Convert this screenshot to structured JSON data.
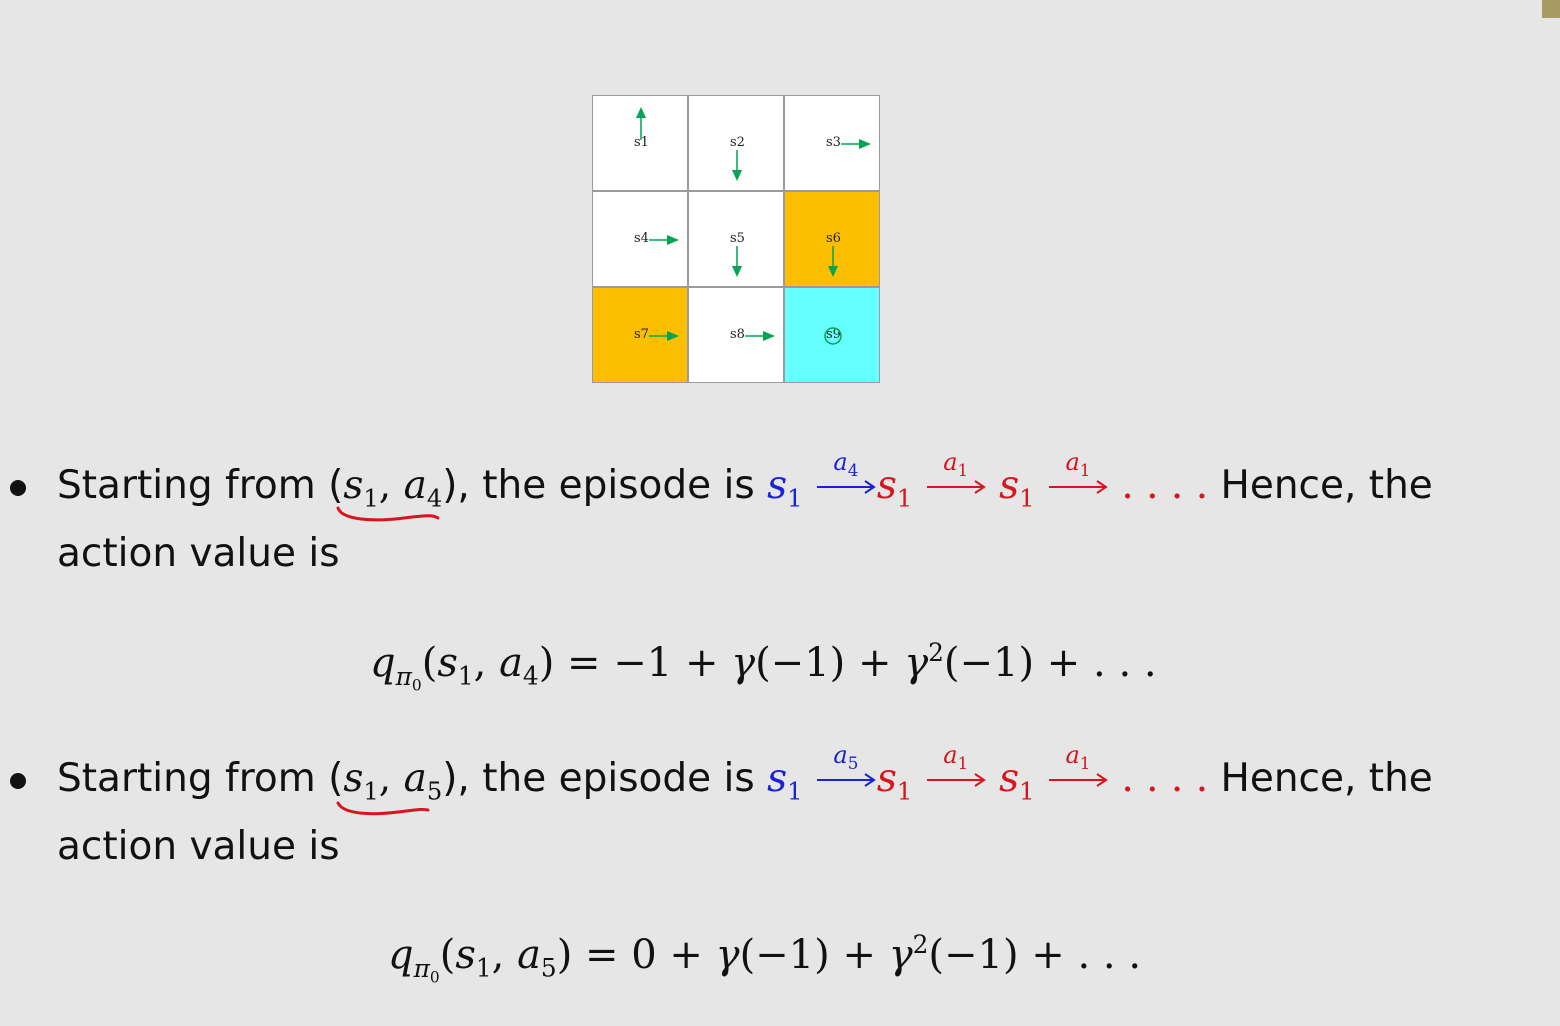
{
  "grid": {
    "cells": [
      {
        "label": "s1",
        "color": "#ffffff",
        "arrow": "up"
      },
      {
        "label": "s2",
        "color": "#ffffff",
        "arrow": "down"
      },
      {
        "label": "s3",
        "color": "#ffffff",
        "arrow": "right"
      },
      {
        "label": "s4",
        "color": "#ffffff",
        "arrow": "right"
      },
      {
        "label": "s5",
        "color": "#ffffff",
        "arrow": "down"
      },
      {
        "label": "s6",
        "color": "#fcbf00",
        "arrow": "down"
      },
      {
        "label": "s7",
        "color": "#fcbf00",
        "arrow": "right"
      },
      {
        "label": "s8",
        "color": "#ffffff",
        "arrow": "right"
      },
      {
        "label": "s9",
        "color": "#66ffff",
        "arrow": "stay"
      }
    ],
    "arrow_color": "#00a651"
  },
  "bullets": [
    {
      "intro": "Starting from (",
      "pair_s": "s",
      "pair_s_sub": "1",
      "pair_comma": ", ",
      "pair_a": "a",
      "pair_a_sub": "4",
      "after_pair": "), the episode is ",
      "ep_s0": "s",
      "ep_s0_sub": "1",
      "ep_a1": "a",
      "ep_a1_sub": "4",
      "ep_s1": "s",
      "ep_s1_sub": "1",
      "ep_a2": "a",
      "ep_a2_sub": "1",
      "ep_s2": "s",
      "ep_s2_sub": "1",
      "ep_a3": "a",
      "ep_a3_sub": "1",
      "ep_dots": ". . . .",
      "hence": " Hence, the",
      "line2": "action value is",
      "eq_q": "q",
      "eq_q_sub": "π",
      "eq_q_subsub": "0",
      "eq_args_open": "(",
      "eq_arg_s": "s",
      "eq_arg_s_sub": "1",
      "eq_arg_comma": ", ",
      "eq_arg_a": "a",
      "eq_arg_a_sub": "4",
      "eq_args_close": ")",
      "eq_rhs_a": " = −1 + ",
      "eq_gamma1": "γ",
      "eq_rhs_b": "(−1) + ",
      "eq_gamma2": "γ",
      "eq_pow": "2",
      "eq_rhs_c": "(−1) + . . ."
    },
    {
      "intro": "Starting from (",
      "pair_s": "s",
      "pair_s_sub": "1",
      "pair_comma": ", ",
      "pair_a": "a",
      "pair_a_sub": "5",
      "after_pair": "), the episode is ",
      "ep_s0": "s",
      "ep_s0_sub": "1",
      "ep_a1": "a",
      "ep_a1_sub": "5",
      "ep_s1": "s",
      "ep_s1_sub": "1",
      "ep_a2": "a",
      "ep_a2_sub": "1",
      "ep_s2": "s",
      "ep_s2_sub": "1",
      "ep_a3": "a",
      "ep_a3_sub": "1",
      "ep_dots": ". . . .",
      "hence": " Hence, the",
      "line2": "action value is",
      "eq_q": "q",
      "eq_q_sub": "π",
      "eq_q_subsub": "0",
      "eq_args_open": "(",
      "eq_arg_s": "s",
      "eq_arg_s_sub": "1",
      "eq_arg_comma": ", ",
      "eq_arg_a": "a",
      "eq_arg_a_sub": "5",
      "eq_args_close": ")",
      "eq_rhs_a": " = 0 + ",
      "eq_gamma1": "γ",
      "eq_rhs_b": "(−1) + ",
      "eq_gamma2": "γ",
      "eq_pow": "2",
      "eq_rhs_c": "(−1) + . . ."
    }
  ],
  "colors": {
    "episode_start": "#1a22d6",
    "episode_rest": "#d8141c",
    "annotation": "#d8141c"
  }
}
